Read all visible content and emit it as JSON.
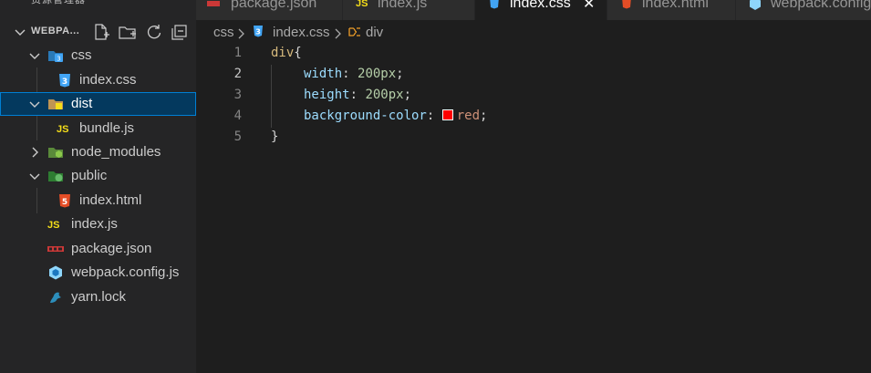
{
  "explorer": {
    "title": "资源管理器",
    "more": "···",
    "section_label": "WEBPA...",
    "actions": [
      "new-file-icon",
      "new-folder-icon",
      "refresh-icon",
      "collapse-all-icon"
    ],
    "items": [
      {
        "label": "css",
        "icon": "css-folder-icon",
        "kind": "folder"
      },
      {
        "label": "index.css",
        "icon": "css-file-icon",
        "kind": "file"
      },
      {
        "label": "dist",
        "icon": "dist-folder-icon",
        "kind": "folder",
        "selected": true
      },
      {
        "label": "bundle.js",
        "icon": "js-file-icon",
        "kind": "file"
      },
      {
        "label": "node_modules",
        "icon": "node-folder-icon",
        "kind": "folder"
      },
      {
        "label": "public",
        "icon": "public-folder-icon",
        "kind": "folder"
      },
      {
        "label": "index.html",
        "icon": "html-file-icon",
        "kind": "file"
      },
      {
        "label": "index.js",
        "icon": "js-file-icon",
        "kind": "file"
      },
      {
        "label": "package.json",
        "icon": "npm-file-icon",
        "kind": "file"
      },
      {
        "label": "webpack.config.js",
        "icon": "webpack-file-icon",
        "kind": "file"
      },
      {
        "label": "yarn.lock",
        "icon": "yarn-file-icon",
        "kind": "file"
      }
    ],
    "js_badge": "JS"
  },
  "tabs": [
    {
      "label": "package.json",
      "icon": "npm-file-icon"
    },
    {
      "label": "index.js",
      "icon": "js-file-icon"
    },
    {
      "label": "index.css",
      "icon": "css-file-icon",
      "active": true
    },
    {
      "label": "index.html",
      "icon": "html-file-icon"
    },
    {
      "label": "webpack.config",
      "icon": "webpack-file-icon"
    }
  ],
  "tab_close": "✕",
  "breadcrumb": {
    "folder": "css",
    "file": "index.css",
    "symbol": "div",
    "separator": ">"
  },
  "editor": {
    "line_numbers": [
      "1",
      "2",
      "3",
      "4",
      "5"
    ],
    "current_line": 2,
    "code": {
      "l1_selector": "div",
      "l1_brace": "{",
      "l2_prop": "width",
      "l2_value": "200px",
      "l3_prop": "height",
      "l3_value": "200px",
      "l4_prop": "background-color",
      "l4_value": "red",
      "l5_brace": "}",
      "colon": ": ",
      "semicolon": ";"
    },
    "swatch_color": "#ff0000"
  },
  "colors": {
    "sidebar_bg": "#252526",
    "editor_bg": "#1e1e1e",
    "selection_bg": "#04395e",
    "selection_border": "#007fd4",
    "css_blue": "#42a5f5",
    "js_yellow": "#f5de19",
    "html_orange": "#e44d26"
  }
}
